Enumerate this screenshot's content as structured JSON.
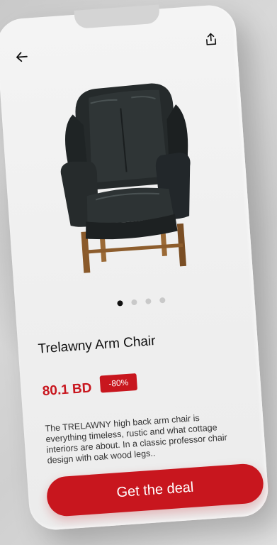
{
  "product": {
    "name": "Trelawny Arm Chair",
    "price": "80.1 BD",
    "discount": "-80%",
    "description": "The TRELAWNY high back arm chair is everything timeless, rustic and what cottage interiors are about. In a classic professor chair design with oak wood legs..",
    "image_icon": "leather-wingback-chair"
  },
  "carousel": {
    "total": 4,
    "active_index": 0
  },
  "header": {
    "back_icon": "arrow-left-icon",
    "share_icon": "share-icon"
  },
  "actions": {
    "cta_label": "Get the deal"
  },
  "colors": {
    "accent": "#c8161e",
    "text": "#111111",
    "dot_inactive": "#c9c9c9"
  }
}
